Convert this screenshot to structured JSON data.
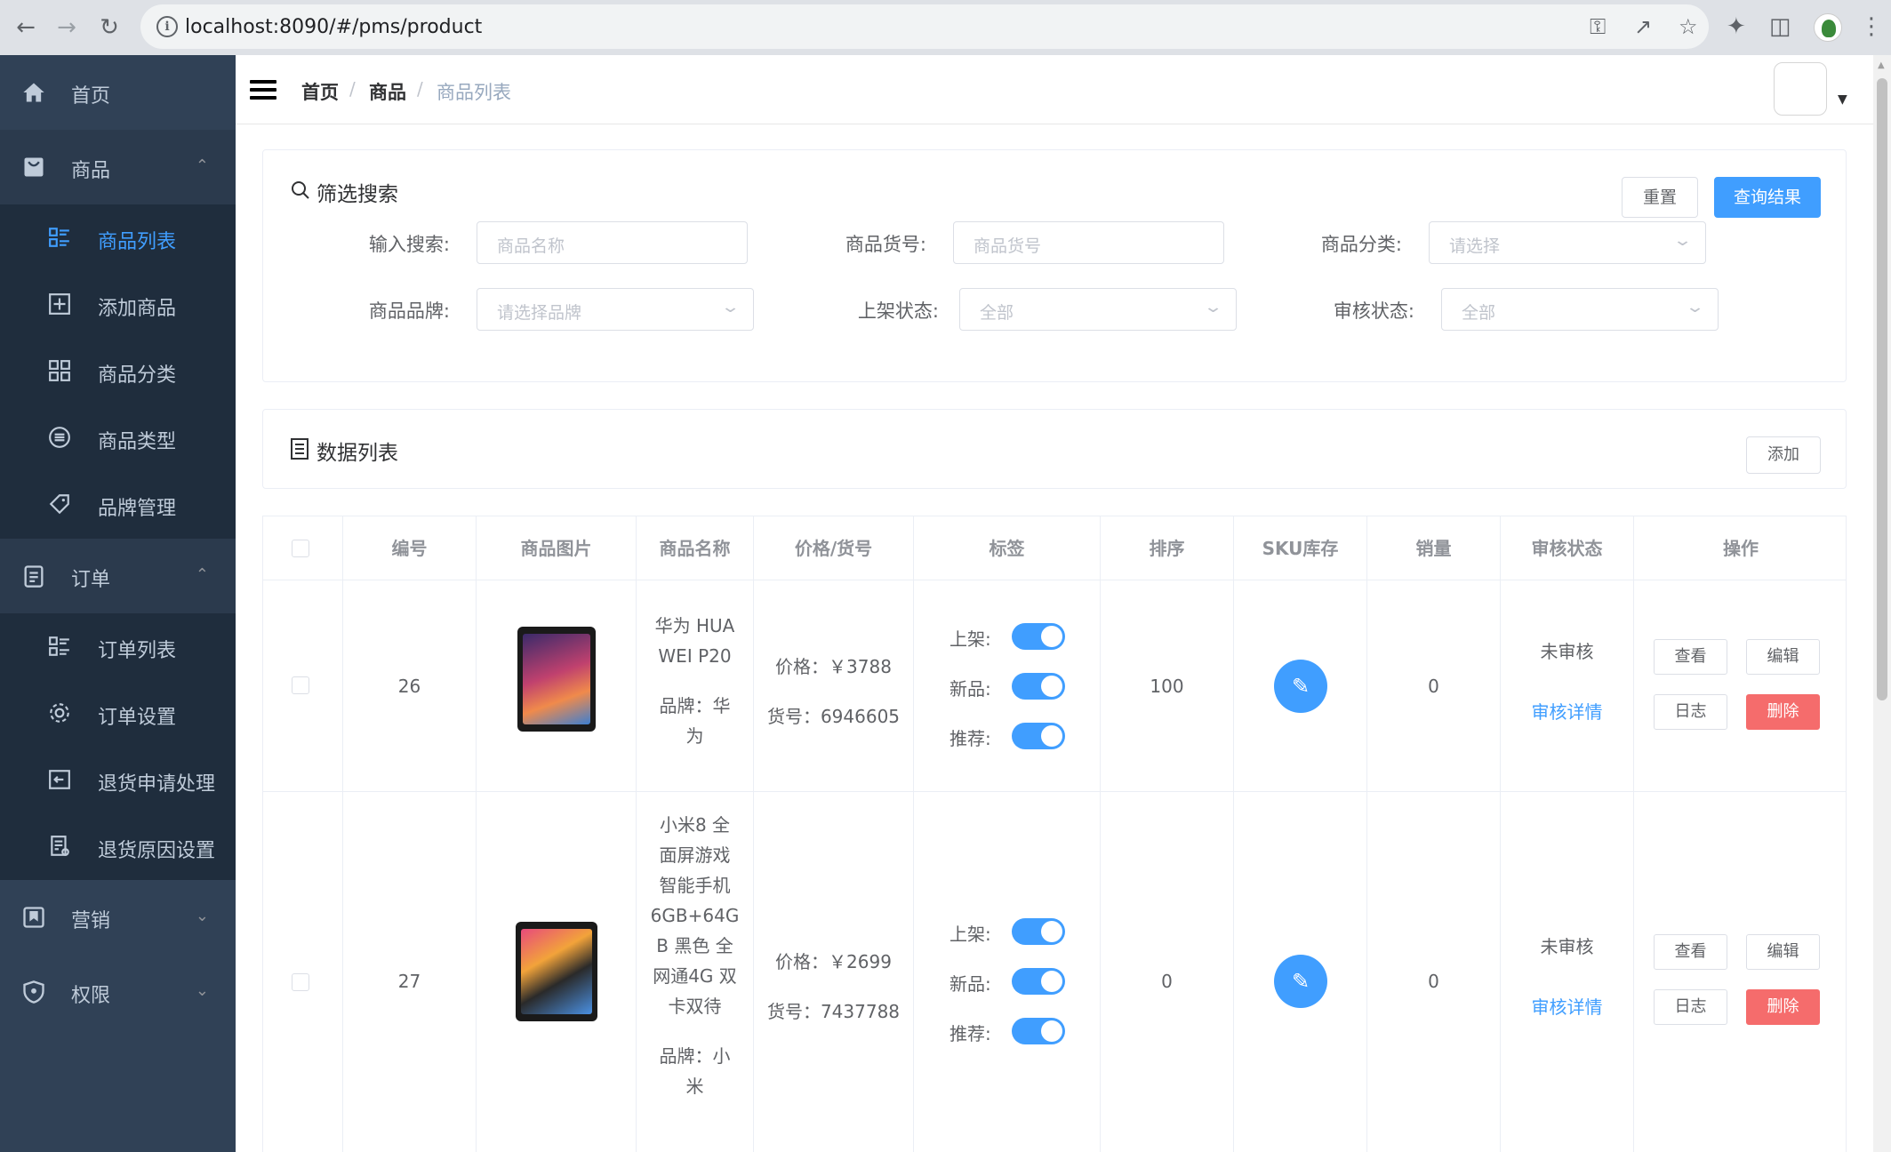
{
  "browser": {
    "url": "localhost:8090/#/pms/product"
  },
  "sidebar": {
    "home": "首页",
    "product_group": "商品",
    "product_items": [
      "商品列表",
      "添加商品",
      "商品分类",
      "商品类型",
      "品牌管理"
    ],
    "order_group": "订单",
    "order_items": [
      "订单列表",
      "订单设置",
      "退货申请处理",
      "退货原因设置"
    ],
    "marketing": "营销",
    "permission": "权限"
  },
  "breadcrumb": [
    "首页",
    "商品",
    "商品列表"
  ],
  "filter": {
    "title": "筛选搜索",
    "reset": "重置",
    "query": "查询结果",
    "fields": [
      {
        "label": "输入搜索:",
        "placeholder": "商品名称"
      },
      {
        "label": "商品货号:",
        "placeholder": "商品货号"
      },
      {
        "label": "商品分类:",
        "placeholder": "请选择"
      },
      {
        "label": "商品品牌:",
        "placeholder": "请选择品牌"
      },
      {
        "label": "上架状态:",
        "placeholder": "全部"
      },
      {
        "label": "审核状态:",
        "placeholder": "全部"
      }
    ]
  },
  "list": {
    "title": "数据列表",
    "add": "添加",
    "columns": [
      "编号",
      "商品图片",
      "商品名称",
      "价格/货号",
      "标签",
      "排序",
      "SKU库存",
      "销量",
      "审核状态",
      "操作"
    ],
    "tag_labels": [
      "上架:",
      "新品:",
      "推荐:"
    ],
    "actions": [
      "查看",
      "编辑",
      "日志",
      "删除"
    ],
    "rows": [
      {
        "id": "26",
        "name_lines": [
          "华为 HUA",
          "WEI P20"
        ],
        "brand_lines": [
          "品牌：华",
          "为"
        ],
        "price": "价格：￥3788",
        "sn": "货号：6946605",
        "sort": "100",
        "sales": "0",
        "status": "未审核",
        "detail": "审核详情",
        "on_sale": true,
        "is_new": true,
        "recommend": true
      },
      {
        "id": "27",
        "name_lines": [
          "小米8 全",
          "面屏游戏",
          "智能手机",
          "6GB+64G",
          "B 黑色 全",
          "网通4G 双",
          "卡双待"
        ],
        "brand_lines": [
          "品牌：小",
          "米"
        ],
        "price": "价格：￥2699",
        "sn": "货号：7437788",
        "sort": "0",
        "sales": "0",
        "status": "未审核",
        "detail": "审核详情",
        "on_sale": true,
        "is_new": true,
        "recommend": true
      }
    ]
  }
}
